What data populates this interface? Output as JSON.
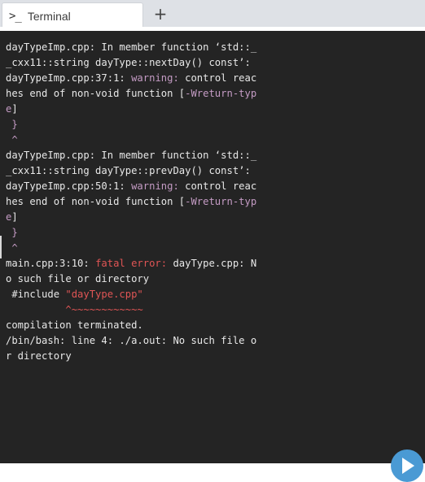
{
  "tabs": {
    "active": {
      "icon": "terminal-prompt-icon",
      "icon_glyph": ">_",
      "label": "Terminal"
    },
    "new_tab_label": "+"
  },
  "terminal": {
    "colors": {
      "background": "#242424",
      "text": "#e8e8e8",
      "warning": "#c49bc4",
      "error": "#e05555"
    },
    "lines": [
      [
        {
          "t": "dayTypeImp.cpp: In member function ‘std::_"
        }
      ],
      [
        {
          "t": "_cxx11::string dayType::nextDay() const’:"
        }
      ],
      [
        {
          "t": "dayTypeImp.cpp:37:1: "
        },
        {
          "t": "warning:",
          "c": "warn"
        },
        {
          "t": " control reac"
        }
      ],
      [
        {
          "t": "hes end of non-void function ["
        },
        {
          "t": "-Wreturn-typ",
          "c": "warn"
        }
      ],
      [
        {
          "t": "e",
          "c": "warn"
        },
        {
          "t": "]"
        }
      ],
      [
        {
          "t": " }",
          "c": "warn"
        }
      ],
      [
        {
          "t": " ^",
          "c": "warn"
        }
      ],
      [
        {
          "t": "dayTypeImp.cpp: In member function ‘std::_"
        }
      ],
      [
        {
          "t": "_cxx11::string dayType::prevDay() const’:"
        }
      ],
      [
        {
          "t": "dayTypeImp.cpp:50:1: "
        },
        {
          "t": "warning:",
          "c": "warn"
        },
        {
          "t": " control reac"
        }
      ],
      [
        {
          "t": "hes end of non-void function ["
        },
        {
          "t": "-Wreturn-typ",
          "c": "warn"
        }
      ],
      [
        {
          "t": "e",
          "c": "warn"
        },
        {
          "t": "]"
        }
      ],
      [
        {
          "t": " }",
          "c": "warn"
        }
      ],
      [
        {
          "t": " ^",
          "c": "warn"
        }
      ],
      [
        {
          "t": "main.cpp:3:10: "
        },
        {
          "t": "fatal error:",
          "c": "err"
        },
        {
          "t": " dayType.cpp: N"
        }
      ],
      [
        {
          "t": "o such file or directory"
        }
      ],
      [
        {
          "t": " #include "
        },
        {
          "t": "\"dayType.cpp\"",
          "c": "err"
        }
      ],
      [
        {
          "t": "          ^~~~~~~~~~~~~",
          "c": "err"
        }
      ],
      [
        {
          "t": "compilation terminated."
        }
      ],
      [
        {
          "t": "/bin/bash: line 4: ./a.out: No such file o"
        }
      ],
      [
        {
          "t": "r directory"
        }
      ]
    ]
  },
  "run_button": {
    "icon": "play-icon",
    "label": "Run"
  }
}
